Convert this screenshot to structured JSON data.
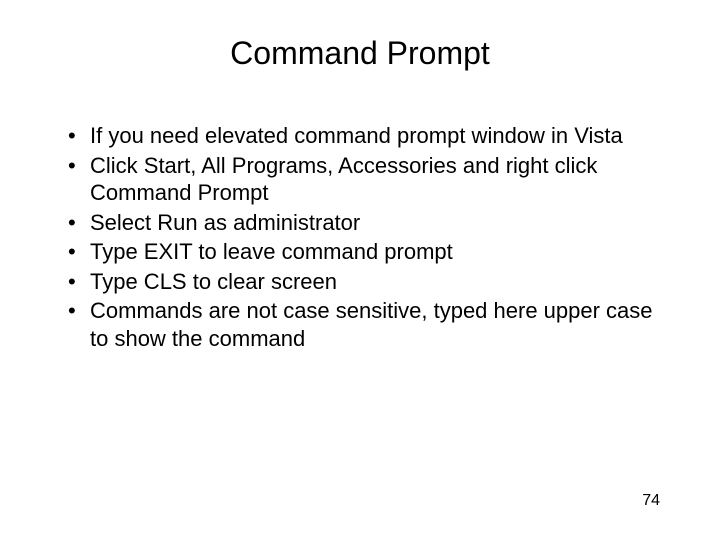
{
  "slide": {
    "title": "Command Prompt",
    "bullets": [
      "If you need elevated command prompt window in Vista",
      "Click Start, All Programs, Accessories and right click Command Prompt",
      "Select Run as administrator",
      "Type EXIT to leave command prompt",
      "Type CLS to clear screen",
      "Commands are not case sensitive, typed here upper case to show the command"
    ],
    "pageNumber": "74"
  }
}
